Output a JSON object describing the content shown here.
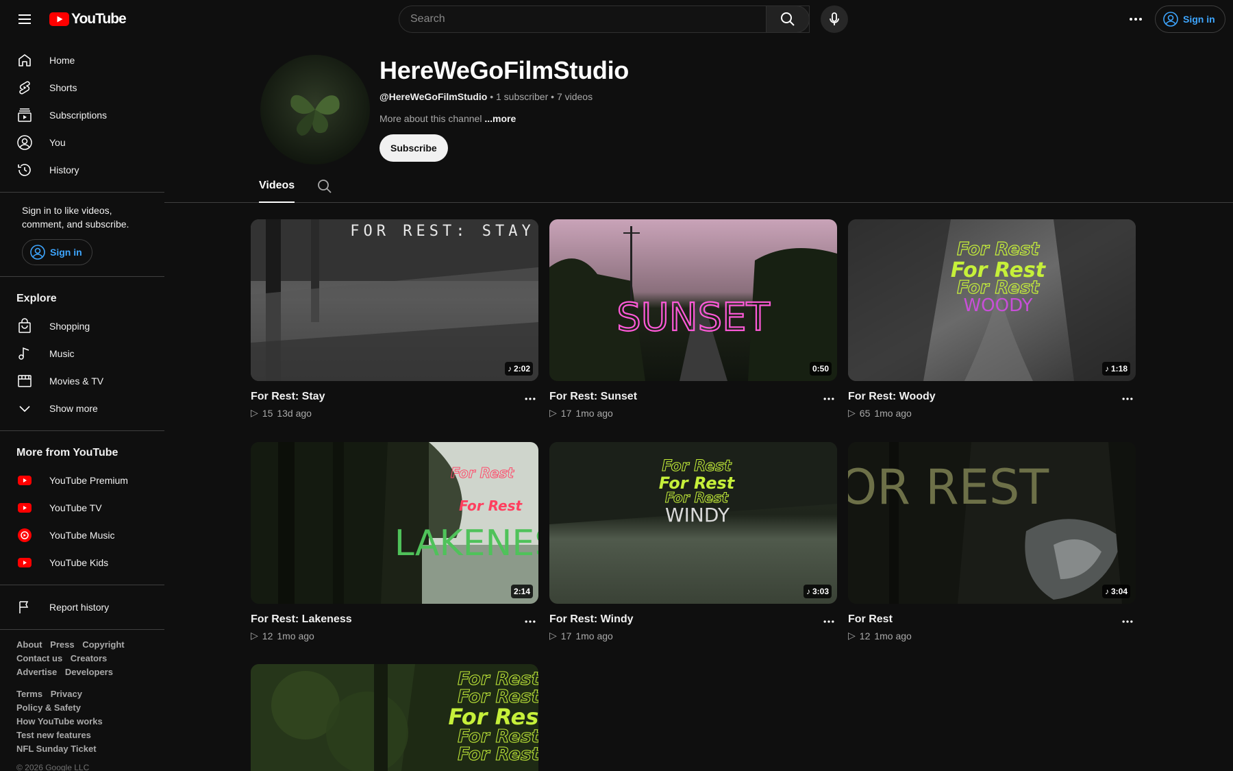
{
  "header": {
    "logo_text": "YouTube",
    "search_placeholder": "Search",
    "signin_label": "Sign in"
  },
  "sidebar": {
    "main_items": [
      {
        "label": "Home",
        "icon": "home-icon"
      },
      {
        "label": "Shorts",
        "icon": "shorts-icon"
      },
      {
        "label": "Subscriptions",
        "icon": "subscriptions-icon"
      },
      {
        "label": "You",
        "icon": "user-icon"
      },
      {
        "label": "History",
        "icon": "history-icon"
      }
    ],
    "signin_prompt": "Sign in to like videos, comment, and subscribe.",
    "signin_label": "Sign in",
    "explore_title": "Explore",
    "explore_items": [
      {
        "label": "Shopping",
        "icon": "shopping-bag-icon"
      },
      {
        "label": "Music",
        "icon": "music-note-icon"
      },
      {
        "label": "Movies & TV",
        "icon": "film-icon"
      },
      {
        "label": "Show more",
        "icon": "chevron-down-icon"
      }
    ],
    "more_title": "More from YouTube",
    "more_items": [
      {
        "label": "YouTube Premium",
        "icon": "youtube-premium-icon"
      },
      {
        "label": "YouTube TV",
        "icon": "youtube-tv-icon"
      },
      {
        "label": "YouTube Music",
        "icon": "youtube-music-icon"
      },
      {
        "label": "YouTube Kids",
        "icon": "youtube-kids-icon"
      }
    ],
    "report_history": "Report history",
    "footer_links_1": [
      "About",
      "Press",
      "Copyright",
      "Contact us",
      "Creators",
      "Advertise",
      "Developers"
    ],
    "footer_links_2": [
      "Terms",
      "Privacy",
      "Policy & Safety",
      "How YouTube works",
      "Test new features",
      "NFL Sunday Ticket"
    ],
    "copyright": "© 2026 Google LLC"
  },
  "channel": {
    "name": "HereWeGoFilmStudio",
    "handle": "@HereWeGoFilmStudio",
    "subscribers": "1 subscriber",
    "videos_count": "7 videos",
    "about": "More about this channel",
    "about_more": "...more",
    "subscribe_label": "Subscribe"
  },
  "tabs": {
    "videos": "Videos"
  },
  "videos": [
    {
      "title": "For Rest: Stay",
      "views": "15",
      "age": "13d ago",
      "duration": "2:02",
      "music": true,
      "overlay": "FOR REST: STAY"
    },
    {
      "title": "For Rest: Sunset",
      "views": "17",
      "age": "1mo ago",
      "duration": "0:50",
      "music": false,
      "overlay": "SUNSET"
    },
    {
      "title": "For Rest: Woody",
      "views": "65",
      "age": "1mo ago",
      "duration": "1:18",
      "music": true,
      "overlay": "WOODY"
    },
    {
      "title": "For Rest: Lakeness",
      "views": "12",
      "age": "1mo ago",
      "duration": "2:14",
      "music": false,
      "overlay": "LAKENESS"
    },
    {
      "title": "For Rest: Windy",
      "views": "17",
      "age": "1mo ago",
      "duration": "3:03",
      "music": true,
      "overlay": "WINDY"
    },
    {
      "title": "For Rest",
      "views": "12",
      "age": "1mo ago",
      "duration": "3:04",
      "music": true,
      "overlay": "FOR REST"
    },
    {
      "title": "",
      "views": "",
      "age": "",
      "duration": "",
      "music": false,
      "overlay": "For Rest"
    }
  ],
  "colors": {
    "background": "#0f0f0f",
    "accent_blue": "#3ea6ff",
    "youtube_red": "#ff0000",
    "lime_text": "#c6f03a",
    "neon_pink": "#ff5ad9"
  }
}
